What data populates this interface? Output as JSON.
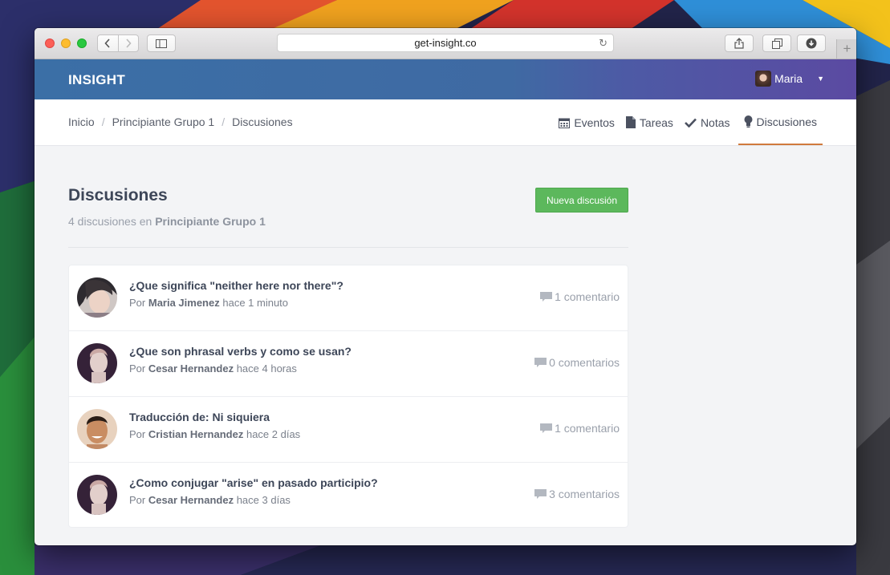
{
  "browser": {
    "url": "get-insight.co"
  },
  "app": {
    "logo": "INSIGHT",
    "user_name": "Maria"
  },
  "breadcrumb": [
    "Inicio",
    "Principiante Grupo 1",
    "Discusiones"
  ],
  "tabs": [
    {
      "label": "Eventos",
      "icon": "calendar-icon"
    },
    {
      "label": "Tareas",
      "icon": "file-icon"
    },
    {
      "label": "Notas",
      "icon": "check-icon"
    },
    {
      "label": "Discusiones",
      "icon": "lightbulb-icon",
      "active": true
    }
  ],
  "page": {
    "title": "Discusiones",
    "subtitle_prefix": "4 discusiones en",
    "subtitle_group": "Principiante Grupo 1",
    "new_button": "Nueva discusión"
  },
  "discussions": [
    {
      "title": "¿Que significa \"neither here nor there\"?",
      "by": "Por",
      "author": "Maria Jimenez",
      "time": "hace 1 minuto",
      "comments": "1 comentario",
      "avatar_color": "#c9a48f"
    },
    {
      "title": "¿Que son phrasal verbs y como se usan?",
      "by": "Por",
      "author": "Cesar Hernandez",
      "time": "hace 4 horas",
      "comments": "0 comentarios",
      "avatar_color": "#3a2440"
    },
    {
      "title": "Traducción de: Ni siquiera",
      "by": "Por",
      "author": "Cristian Hernandez",
      "time": "hace 2 días",
      "comments": "1 comentario",
      "avatar_color": "#c88a5e"
    },
    {
      "title": "¿Como conjugar \"arise\" en pasado participio?",
      "by": "Por",
      "author": "Cesar Hernandez",
      "time": "hace 3 días",
      "comments": "3 comentarios",
      "avatar_color": "#3a2440"
    }
  ],
  "colors": {
    "header_start": "#3b6fa6",
    "header_end": "#5b4aa2",
    "active_tab_underline": "#d07a3d",
    "primary_button": "#5cb85c"
  }
}
